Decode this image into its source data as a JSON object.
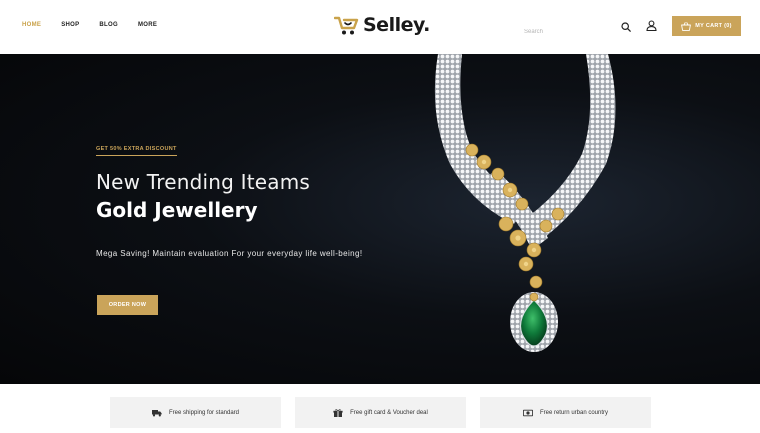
{
  "nav": {
    "items": [
      {
        "label": "HOME",
        "active": true
      },
      {
        "label": "SHOP",
        "active": false
      },
      {
        "label": "BLOG",
        "active": false
      },
      {
        "label": "MORE",
        "active": false
      }
    ]
  },
  "logo": {
    "text": "Selley.",
    "icon": "shopping-cart-logo-icon"
  },
  "search": {
    "placeholder": "Search",
    "icon": "search-icon"
  },
  "account": {
    "icon": "user-icon"
  },
  "cart": {
    "label": "MY CART (0)",
    "icon": "basket-icon"
  },
  "hero": {
    "discount": "GET 50% EXTRA DISCOUNT",
    "title": "New Trending Iteams",
    "subtitle": "Gold Jewellery",
    "description": "Mega Saving! Maintain evaluation For your everyday life well-being!",
    "button": "ORDER NOW",
    "image": "diamond-emerald-necklace"
  },
  "features": [
    {
      "icon": "truck-icon",
      "text": "Free shipping for standard"
    },
    {
      "icon": "gift-icon",
      "text": "Free gift card & Voucher deal"
    },
    {
      "icon": "money-icon",
      "text": "Free return urban country"
    }
  ],
  "colors": {
    "accent": "#caa45a",
    "hero_background": "#07090c",
    "feature_background": "#f2f2f2",
    "text_dark": "#1a1a1a"
  }
}
